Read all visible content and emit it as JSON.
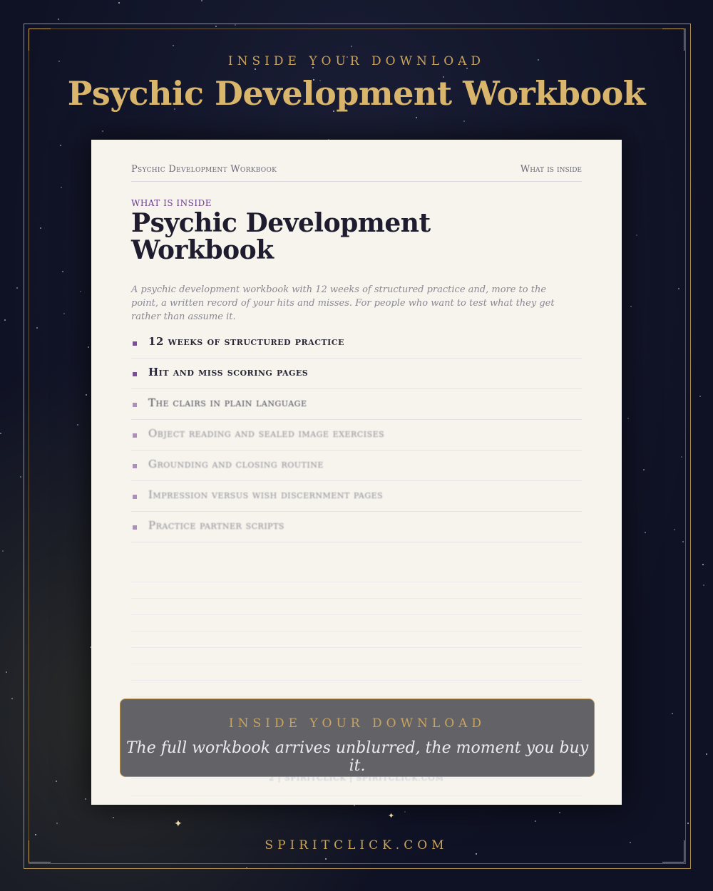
{
  "banner": {
    "eyebrow": "INSIDE YOUR DOWNLOAD",
    "title": "Psychic Development Workbook"
  },
  "page": {
    "header_left": "Psychic Development Workbook",
    "header_right": "What is inside",
    "section_label": "WHAT IS INSIDE",
    "title": "Psychic Development Workbook",
    "intro": "A psychic development workbook with 12 weeks of structured practice and, more to the point, a written record of your hits and misses. For people who want to test what they get rather than assume it.",
    "items": [
      "12 weeks of structured practice",
      "Hit and miss scoring pages",
      "The clairs in plain language",
      "Object reading and sealed image exercises",
      "Grounding and closing routine",
      "Impression versus wish discernment pages",
      "Practice partner scripts"
    ],
    "footer": "2 | SPIRITCLICK | SPIRITCLICK.COM"
  },
  "cta": {
    "eyebrow": "INSIDE YOUR DOWNLOAD",
    "message": "The full workbook arrives unblurred, the moment you buy it."
  },
  "site_url": "SPIRITCLICK.COM",
  "colors": {
    "background": "#121529",
    "gold": "#c9a45c",
    "accent_purple": "#7a4e98",
    "paper": "#f6f4ec"
  }
}
